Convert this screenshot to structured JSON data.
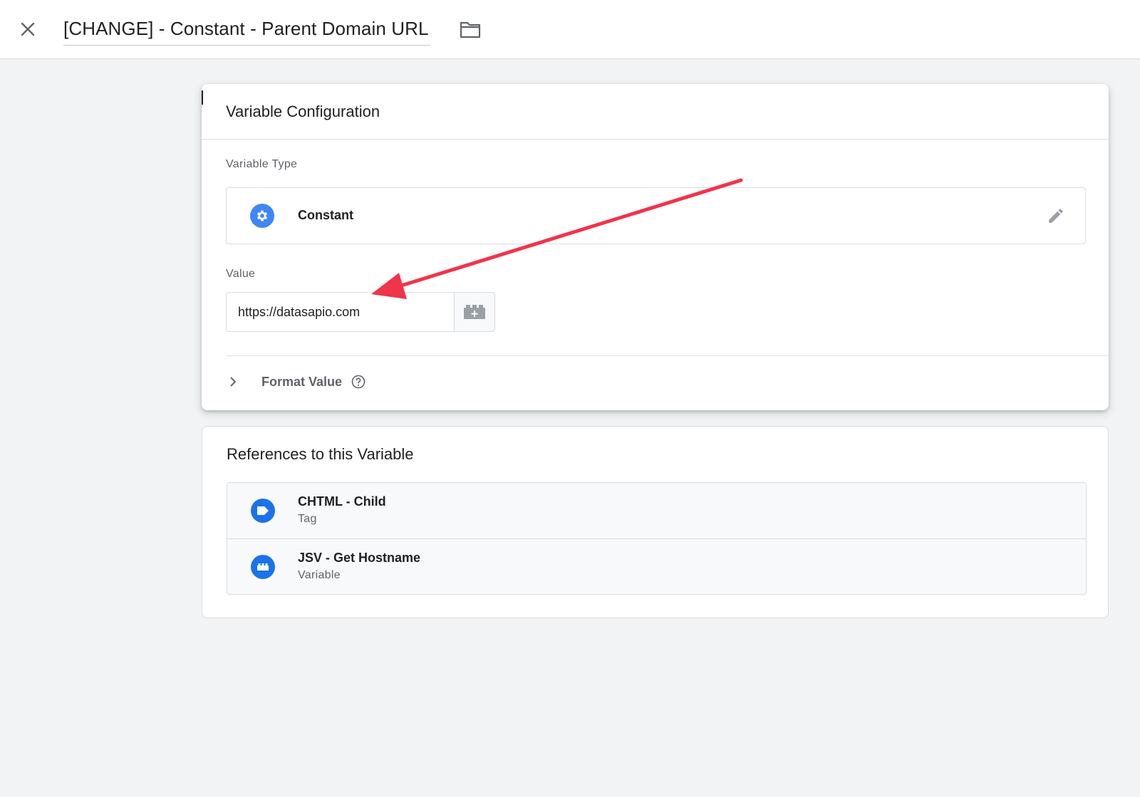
{
  "header": {
    "title": "[CHANGE] - Constant - Parent Domain URL"
  },
  "config": {
    "card_title": "Variable Configuration",
    "type_label": "Variable Type",
    "type_name": "Constant",
    "value_label": "Value",
    "value": "https://datasapio.com",
    "format_label": "Format Value"
  },
  "references": {
    "title": "References to this Variable",
    "items": [
      {
        "name": "CHTML - Child",
        "kind": "Tag",
        "icon": "tag-icon"
      },
      {
        "name": "JSV - Get Hostname",
        "kind": "Variable",
        "icon": "variable-block-icon"
      }
    ]
  },
  "colors": {
    "accent": "#4285f4",
    "ref_icon": "#1a73e8",
    "annotation_arrow": "#f0344a"
  }
}
